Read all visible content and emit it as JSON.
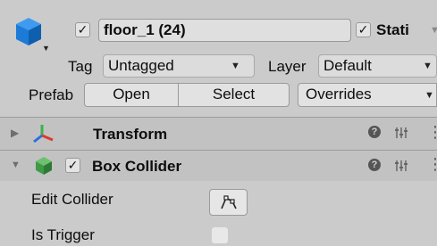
{
  "header": {
    "active": true,
    "object_name": "floor_1 (24)",
    "static": true,
    "static_label": "Stati",
    "tag_label": "Tag",
    "tag_value": "Untagged",
    "layer_label": "Layer",
    "layer_value": "Default"
  },
  "prefab": {
    "label": "Prefab",
    "open": "Open",
    "select": "Select",
    "overrides": "Overrides"
  },
  "components": [
    {
      "name": "Transform",
      "expanded": false
    },
    {
      "name": "Box Collider",
      "expanded": true,
      "enabled": true
    }
  ],
  "box_collider": {
    "edit_collider_label": "Edit Collider",
    "is_trigger_label": "Is Trigger",
    "is_trigger": false
  },
  "glyphs": {
    "check": "✓",
    "dropdown": "▼",
    "foldout_closed": "▶",
    "foldout_open": "▼",
    "help": "❓",
    "settings": "⚙",
    "more": "⋮"
  },
  "colors": {
    "cube_blue": "#1c7bd6",
    "box_green": "#3f9a47",
    "axis_red": "#e03a2a",
    "axis_green": "#3bb34a",
    "axis_blue": "#2b6ee0"
  }
}
